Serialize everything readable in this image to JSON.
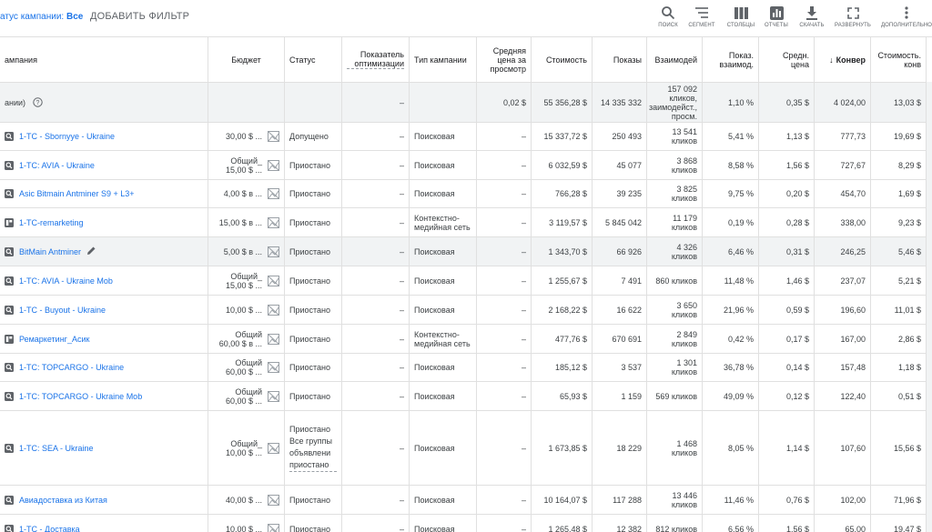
{
  "toolbar": {
    "status_label": "атус кампании:",
    "status_value": "Все",
    "add_filter": "ДОБАВИТЬ ФИЛЬТР",
    "tools": [
      {
        "label": "ПОИСК",
        "icon": "search-icon"
      },
      {
        "label": "СЕГМЕНТ",
        "icon": "segment-icon"
      },
      {
        "label": "СТОЛБЦЫ",
        "icon": "columns-icon"
      },
      {
        "label": "ОТЧЕТЫ",
        "icon": "reports-icon"
      },
      {
        "label": "СКАЧАТЬ",
        "icon": "download-icon"
      },
      {
        "label": "РАЗВЕРНУТЬ",
        "icon": "expand-icon"
      },
      {
        "label": "ДОПОЛНИТЕЛЬНО",
        "icon": "more-icon"
      }
    ]
  },
  "columns": {
    "campaign": "ампания",
    "budget": "Бюджет",
    "status": "Статус",
    "opt": "Показатель оптимизации",
    "type": "Тип кампании",
    "avg_view": "Средняя цена за просмотр",
    "cost": "Стоимость",
    "impr": "Показы",
    "inter": "Взаимодей",
    "inter_rate": "Показ. взаимод.",
    "avg_cost": "Средн. цена",
    "conv": "Конвер",
    "conv_cost": "Стоимость. конв",
    "sort_arrow": "↓"
  },
  "total": {
    "label": "ании)",
    "opt": "–",
    "avg_view": "0,02 $",
    "cost": "55 356,28 $",
    "impr": "14 335 332",
    "inter": "157 092 кликов, заимодейст., просм.",
    "inter_rate": "1,10 %",
    "avg_cost": "0,35 $",
    "conv": "4 024,00",
    "conv_cost": "13,03 $"
  },
  "rows": [
    {
      "icon": "search",
      "name": "1-TC - Sbornyye - Ukraine",
      "budget": "30,00 $ ...",
      "status": "Допущено",
      "opt": "–",
      "type": "Поисковая",
      "avg_view": "–",
      "cost": "15 337,72 $",
      "impr": "250 493",
      "inter": "13 541 кликов",
      "inter_rate": "5,41 %",
      "avg_cost": "1,13 $",
      "conv": "777,73",
      "conv_cost": "19,69 $"
    },
    {
      "icon": "search",
      "name": "1-TC: AVIA - Ukraine",
      "budget": "Общий_ 15,00 $ ...",
      "status": "Приостано",
      "opt": "–",
      "type": "Поисковая",
      "avg_view": "–",
      "cost": "6 032,59 $",
      "impr": "45 077",
      "inter": "3 868 кликов",
      "inter_rate": "8,58 %",
      "avg_cost": "1,56 $",
      "conv": "727,67",
      "conv_cost": "8,29 $"
    },
    {
      "icon": "search",
      "name": "Asic Bitmain Antminer S9 + L3+",
      "budget": "4,00 $ в ...",
      "status": "Приостано",
      "opt": "–",
      "type": "Поисковая",
      "avg_view": "–",
      "cost": "766,28 $",
      "impr": "39 235",
      "inter": "3 825 кликов",
      "inter_rate": "9,75 %",
      "avg_cost": "0,20 $",
      "conv": "454,70",
      "conv_cost": "1,69 $"
    },
    {
      "icon": "display",
      "name": "1-TC-remarketing",
      "budget": "15,00 $ в ...",
      "status": "Приостано",
      "opt": "–",
      "type": "Контекстно-медийная сеть",
      "avg_view": "–",
      "cost": "3 119,57 $",
      "impr": "5 845 042",
      "inter": "11 179 кликов",
      "inter_rate": "0,19 %",
      "avg_cost": "0,28 $",
      "conv": "338,00",
      "conv_cost": "9,23 $"
    },
    {
      "icon": "search",
      "name": "BitMain Antminer",
      "budget": "5,00 $ в ...",
      "status": "Приостано",
      "opt": "–",
      "type": "Поисковая",
      "avg_view": "–",
      "cost": "1 343,70 $",
      "impr": "66 926",
      "inter": "4 326 кликов",
      "inter_rate": "6,46 %",
      "avg_cost": "0,31 $",
      "conv": "246,25",
      "conv_cost": "5,46 $",
      "hl": true
    },
    {
      "icon": "search",
      "name": "1-TC: AVIA - Ukraine Mob",
      "budget": "Общий_ 15,00 $ ...",
      "status": "Приостано",
      "opt": "–",
      "type": "Поисковая",
      "avg_view": "–",
      "cost": "1 255,67 $",
      "impr": "7 491",
      "inter": "860 кликов",
      "inter_rate": "11,48 %",
      "avg_cost": "1,46 $",
      "conv": "237,07",
      "conv_cost": "5,21 $"
    },
    {
      "icon": "search",
      "name": "1-TC - Buyout - Ukraine",
      "budget": "10,00 $ ...",
      "status": "Приостано",
      "opt": "–",
      "type": "Поисковая",
      "avg_view": "–",
      "cost": "2 168,22 $",
      "impr": "16 622",
      "inter": "3 650 кликов",
      "inter_rate": "21,96 %",
      "avg_cost": "0,59 $",
      "conv": "196,60",
      "conv_cost": "11,01 $"
    },
    {
      "icon": "display",
      "name": "Ремаркетинг_Асик",
      "budget": "Общий 60,00 $ в ...",
      "status": "Приостано",
      "opt": "–",
      "type": "Контекстно-медийная сеть",
      "avg_view": "–",
      "cost": "477,76 $",
      "impr": "670 691",
      "inter": "2 849 кликов",
      "inter_rate": "0,42 %",
      "avg_cost": "0,17 $",
      "conv": "167,00",
      "conv_cost": "2,86 $"
    },
    {
      "icon": "search",
      "name": "1-TC: TOPCARGO - Ukraine",
      "budget": "Общий 60,00 $ ...",
      "status": "Приостано",
      "opt": "–",
      "type": "Поисковая",
      "avg_view": "–",
      "cost": "185,12 $",
      "impr": "3 537",
      "inter": "1 301 кликов",
      "inter_rate": "36,78 %",
      "avg_cost": "0,14 $",
      "conv": "157,48",
      "conv_cost": "1,18 $"
    },
    {
      "icon": "search",
      "name": "1-TC: TOPCARGO - Ukraine Mob",
      "budget": "Общий 60,00 $ ...",
      "status": "Приостано",
      "opt": "–",
      "type": "Поисковая",
      "avg_view": "–",
      "cost": "65,93 $",
      "impr": "1 159",
      "inter": "569 кликов",
      "inter_rate": "49,09 %",
      "avg_cost": "0,12 $",
      "conv": "122,40",
      "conv_cost": "0,51 $"
    },
    {
      "icon": "search",
      "name": "1-TC: SEA - Ukraine",
      "budget": "Общий_ 10,00 $ ...",
      "status": "Приостано Все группы объявлени приостано",
      "opt": "–",
      "type": "Поисковая",
      "avg_view": "–",
      "cost": "1 673,85 $",
      "impr": "18 229",
      "inter": "1 468 кликов",
      "inter_rate": "8,05 %",
      "avg_cost": "1,14 $",
      "conv": "107,60",
      "conv_cost": "15,56 $",
      "tall": true
    },
    {
      "icon": "search",
      "name": "Авиадоставка из Китая",
      "budget": "40,00 $ ...",
      "status": "Приостано",
      "opt": "–",
      "type": "Поисковая",
      "avg_view": "–",
      "cost": "10 164,07 $",
      "impr": "117 288",
      "inter": "13 446 кликов",
      "inter_rate": "11,46 %",
      "avg_cost": "0,76 $",
      "conv": "102,00",
      "conv_cost": "71,96 $"
    },
    {
      "icon": "search",
      "name": "1-TC - Доставка",
      "budget": "10,00 $ ...",
      "status": "Приостано",
      "opt": "–",
      "type": "Поисковая",
      "avg_view": "–",
      "cost": "1 265,48 $",
      "impr": "12 382",
      "inter": "812 кликов",
      "inter_rate": "6,56 %",
      "avg_cost": "1,56 $",
      "conv": "65,00",
      "conv_cost": "19,47 $"
    }
  ]
}
